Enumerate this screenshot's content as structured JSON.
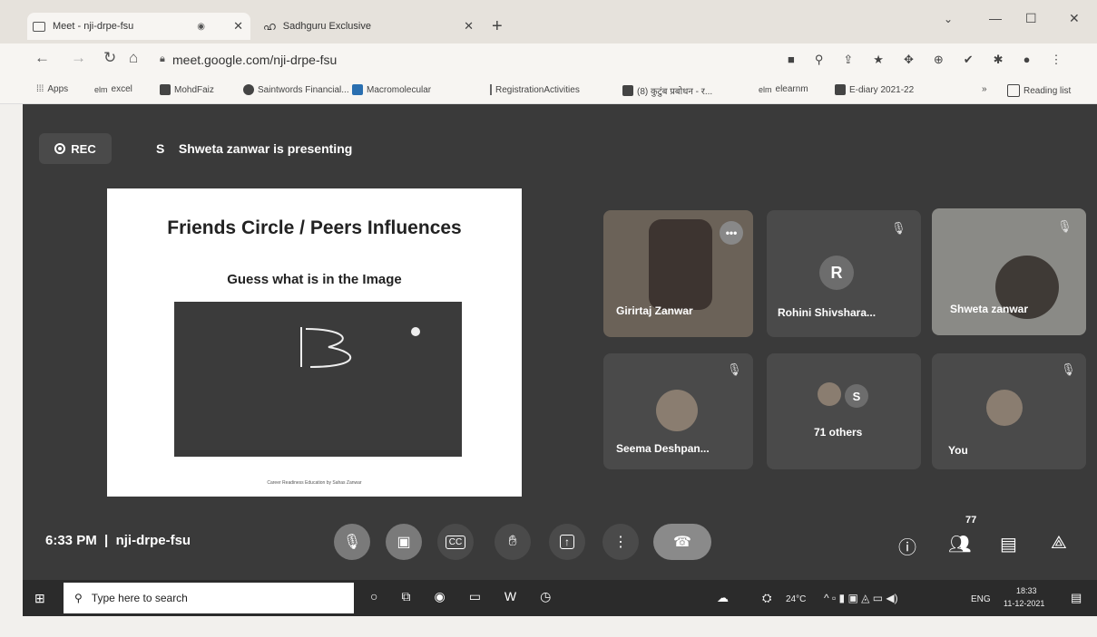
{
  "browser": {
    "tabs": [
      {
        "title": "Meet - nji-drpe-fsu",
        "active": true
      },
      {
        "title": "Sadhguru Exclusive",
        "active": false
      }
    ],
    "new_tab": "+",
    "window_controls": {
      "minimize": "—",
      "maximize": "☐",
      "close": "✕"
    },
    "url": "meet.google.com/nji-drpe-fsu",
    "bookmarks": [
      "Apps",
      "excel",
      "MohdFaiz",
      "Saintwords Financial...",
      "Macromolecular",
      "RegistrationActivities",
      "(8) कुटुंब प्रबोधन - र...",
      "elearnm",
      "E-diary 2021-22"
    ],
    "bookmarks_overflow": "»",
    "reading_list": "Reading list"
  },
  "meet": {
    "rec_label": "REC",
    "presenter_initial": "S",
    "presenter_text": "Shweta zanwar is presenting",
    "slide": {
      "title": "Friends Circle / Peers Influences",
      "subtitle": "Guess what is in the Image",
      "footer": "Career Readiness Education by Sahas Zanwar"
    },
    "participants": [
      {
        "name": "Girirtaj Zanwar"
      },
      {
        "name": "Rohini Shivshara...",
        "initial": "R"
      },
      {
        "name": "Shweta zanwar"
      },
      {
        "name": "Seema Deshpan..."
      },
      {
        "name": "71 others",
        "initial": "S"
      },
      {
        "name": "You"
      }
    ],
    "clock": "6:33 PM",
    "meeting_code": "nji-drpe-fsu",
    "participant_count": "77"
  },
  "taskbar": {
    "search_placeholder": "Type here to search",
    "temperature": "24°C",
    "language": "ENG",
    "time": "18:33",
    "date": "11-12-2021"
  }
}
